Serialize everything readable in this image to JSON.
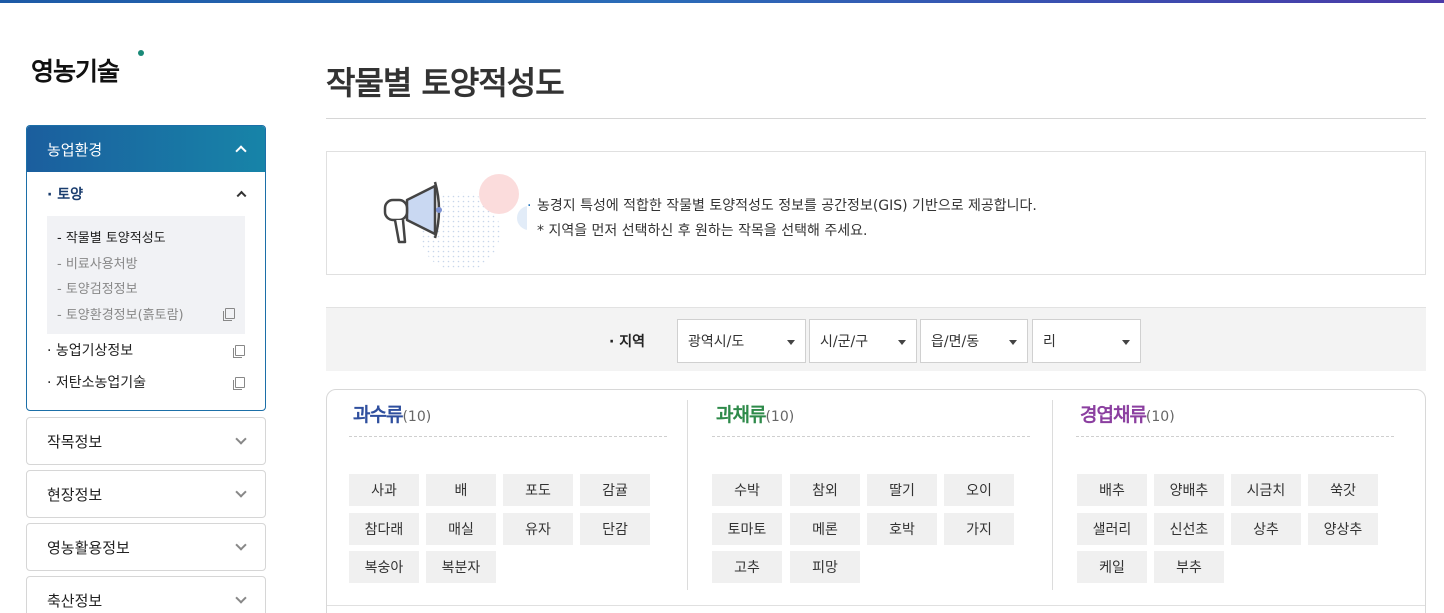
{
  "brand": "영농기술",
  "sidebar": {
    "open_menu": {
      "label": "농업환경"
    },
    "submenu": {
      "label": "· 토양"
    },
    "subitems": [
      {
        "label": "- 작물별 토양적성도",
        "active": true
      },
      {
        "label": "- 비료사용처방"
      },
      {
        "label": "- 토양검정정보"
      },
      {
        "label": "- 토양환경정보(흙토람)",
        "external": true
      }
    ],
    "items": [
      {
        "label": "· 농업기상정보",
        "external": true
      },
      {
        "label": "· 저탄소농업기술",
        "external": true
      }
    ],
    "closed_menus": [
      "작목정보",
      "현장정보",
      "영농활용정보",
      "축산정보"
    ]
  },
  "page": {
    "title": "작물별 토양적성도",
    "info": [
      "농경지 특성에 적합한 작물별 토양적성도 정보를 공간정보(GIS) 기반으로 제공합니다.",
      "* 지역을 먼저 선택하신 후 원하는 작목을 선택해 주세요."
    ]
  },
  "filter": {
    "label": "· 지역",
    "selects": [
      "광역시/도",
      "시/군/구",
      "읍/면/동",
      "리"
    ]
  },
  "categories": [
    {
      "name": "과수류",
      "count": "(10)",
      "color": "#2f4f9e",
      "crops": [
        "사과",
        "배",
        "포도",
        "감귤",
        "참다래",
        "매실",
        "유자",
        "단감",
        "복숭아",
        "복분자"
      ]
    },
    {
      "name": "과채류",
      "count": "(10)",
      "color": "#2e8a4a",
      "crops": [
        "수박",
        "참외",
        "딸기",
        "오이",
        "토마토",
        "메론",
        "호박",
        "가지",
        "고추",
        "피망"
      ]
    },
    {
      "name": "경엽채류",
      "count": "(10)",
      "color": "#8b3fa0",
      "crops": [
        "배추",
        "양배추",
        "시금치",
        "쑥갓",
        "샐러리",
        "신선초",
        "상추",
        "양상추",
        "케일",
        "부추"
      ]
    }
  ]
}
